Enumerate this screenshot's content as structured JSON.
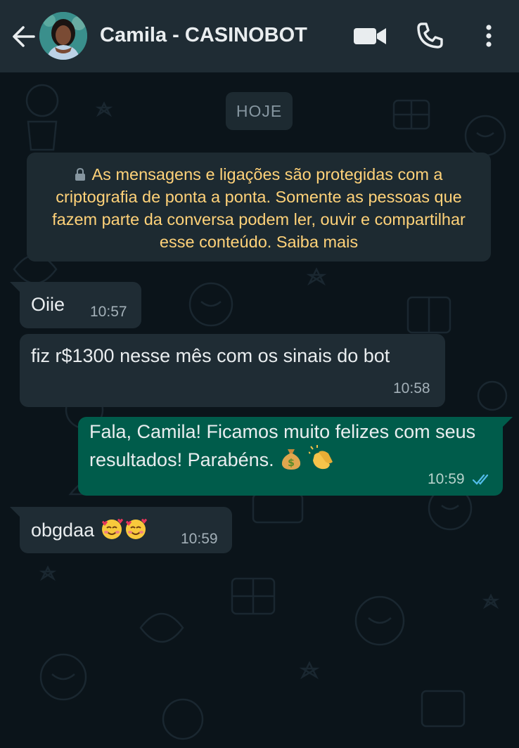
{
  "header": {
    "title": "Camila - CASINOBOT",
    "back_icon": "arrow-left-icon",
    "video_icon": "video-camera-icon",
    "phone_icon": "phone-icon",
    "menu_icon": "more-vertical-icon"
  },
  "chat": {
    "date_label": "HOJE",
    "encryption_notice": "As mensagens e ligações são protegidas com a criptografia de ponta a ponta. Somente as pessoas que fazem parte da conversa podem ler, ouvir e compartilhar esse conteúdo. Saiba mais",
    "messages": [
      {
        "direction": "incoming",
        "text": "Oiie",
        "time": "10:57"
      },
      {
        "direction": "incoming",
        "text": "fiz r$1300 nesse mês com os sinais do bot",
        "time": "10:58"
      },
      {
        "direction": "outgoing",
        "text": "Fala, Camila! Ficamos muito felizes com seus resultados! Parabéns.",
        "emojis": [
          "money-bag-emoji",
          "clapping-hands-emoji"
        ],
        "time": "10:59",
        "status": "read"
      },
      {
        "direction": "incoming",
        "text": "obgdaa",
        "emojis": [
          "smiling-face-with-hearts-emoji",
          "smiling-face-with-hearts-emoji"
        ],
        "time": "10:59"
      }
    ]
  },
  "colors": {
    "header_bg": "#1f2c34",
    "chat_bg": "#0b141a",
    "incoming_bubble": "#1f2c34",
    "outgoing_bubble": "#005c4b",
    "encryption_text": "#ffd279",
    "read_ticks": "#53bdeb"
  }
}
